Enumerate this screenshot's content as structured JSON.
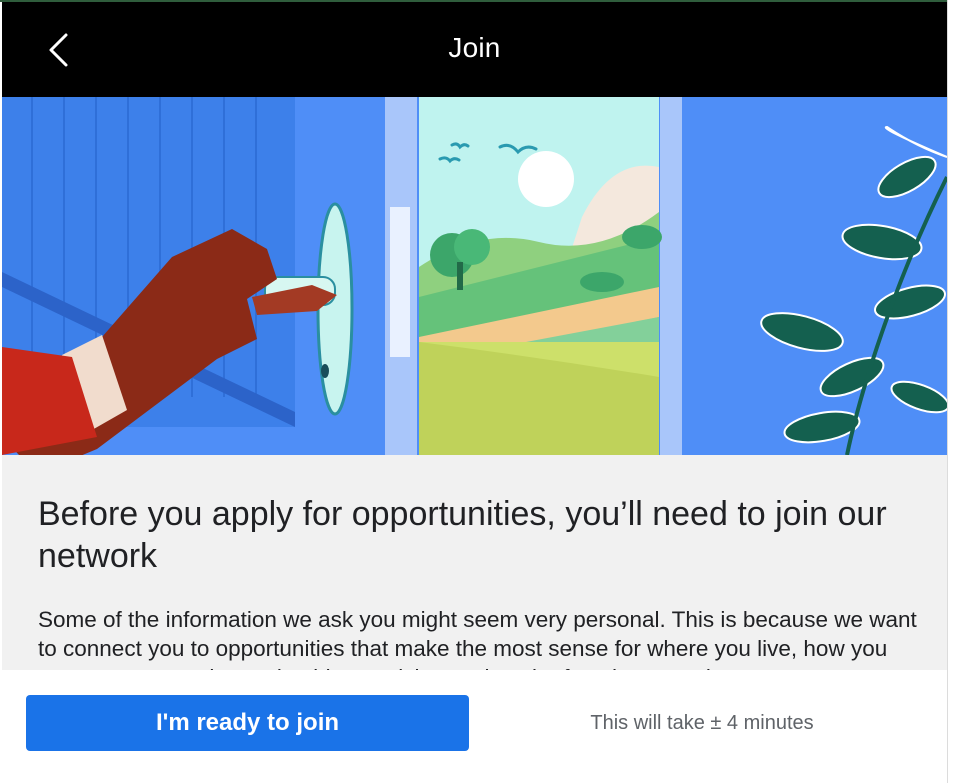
{
  "header": {
    "title": "Join",
    "back_icon": "chevron-left-icon"
  },
  "hero": {
    "illustration": "hand-opening-door-to-landscape",
    "colors": {
      "wall": "#4f8ef7",
      "door_panel": "#3c82ec",
      "sky": "#bff3ef",
      "meadow": "#cde06a",
      "skin": "#8b2a17",
      "sleeve": "#c8281b",
      "leaves": "#14604f"
    }
  },
  "main": {
    "heading": "Before you apply for opportunities, you’ll need to join our network",
    "paragraph": "Some of the information we ask you might seem very personal. This is because we want to connect you to opportunities that make the most sense for where you live, how you want to grow, and to make things quicker and easier for when you do"
  },
  "footer": {
    "cta_label": "I'm ready to join",
    "time_note": "This will take ± 4 minutes",
    "accent": "#1a73e8"
  }
}
